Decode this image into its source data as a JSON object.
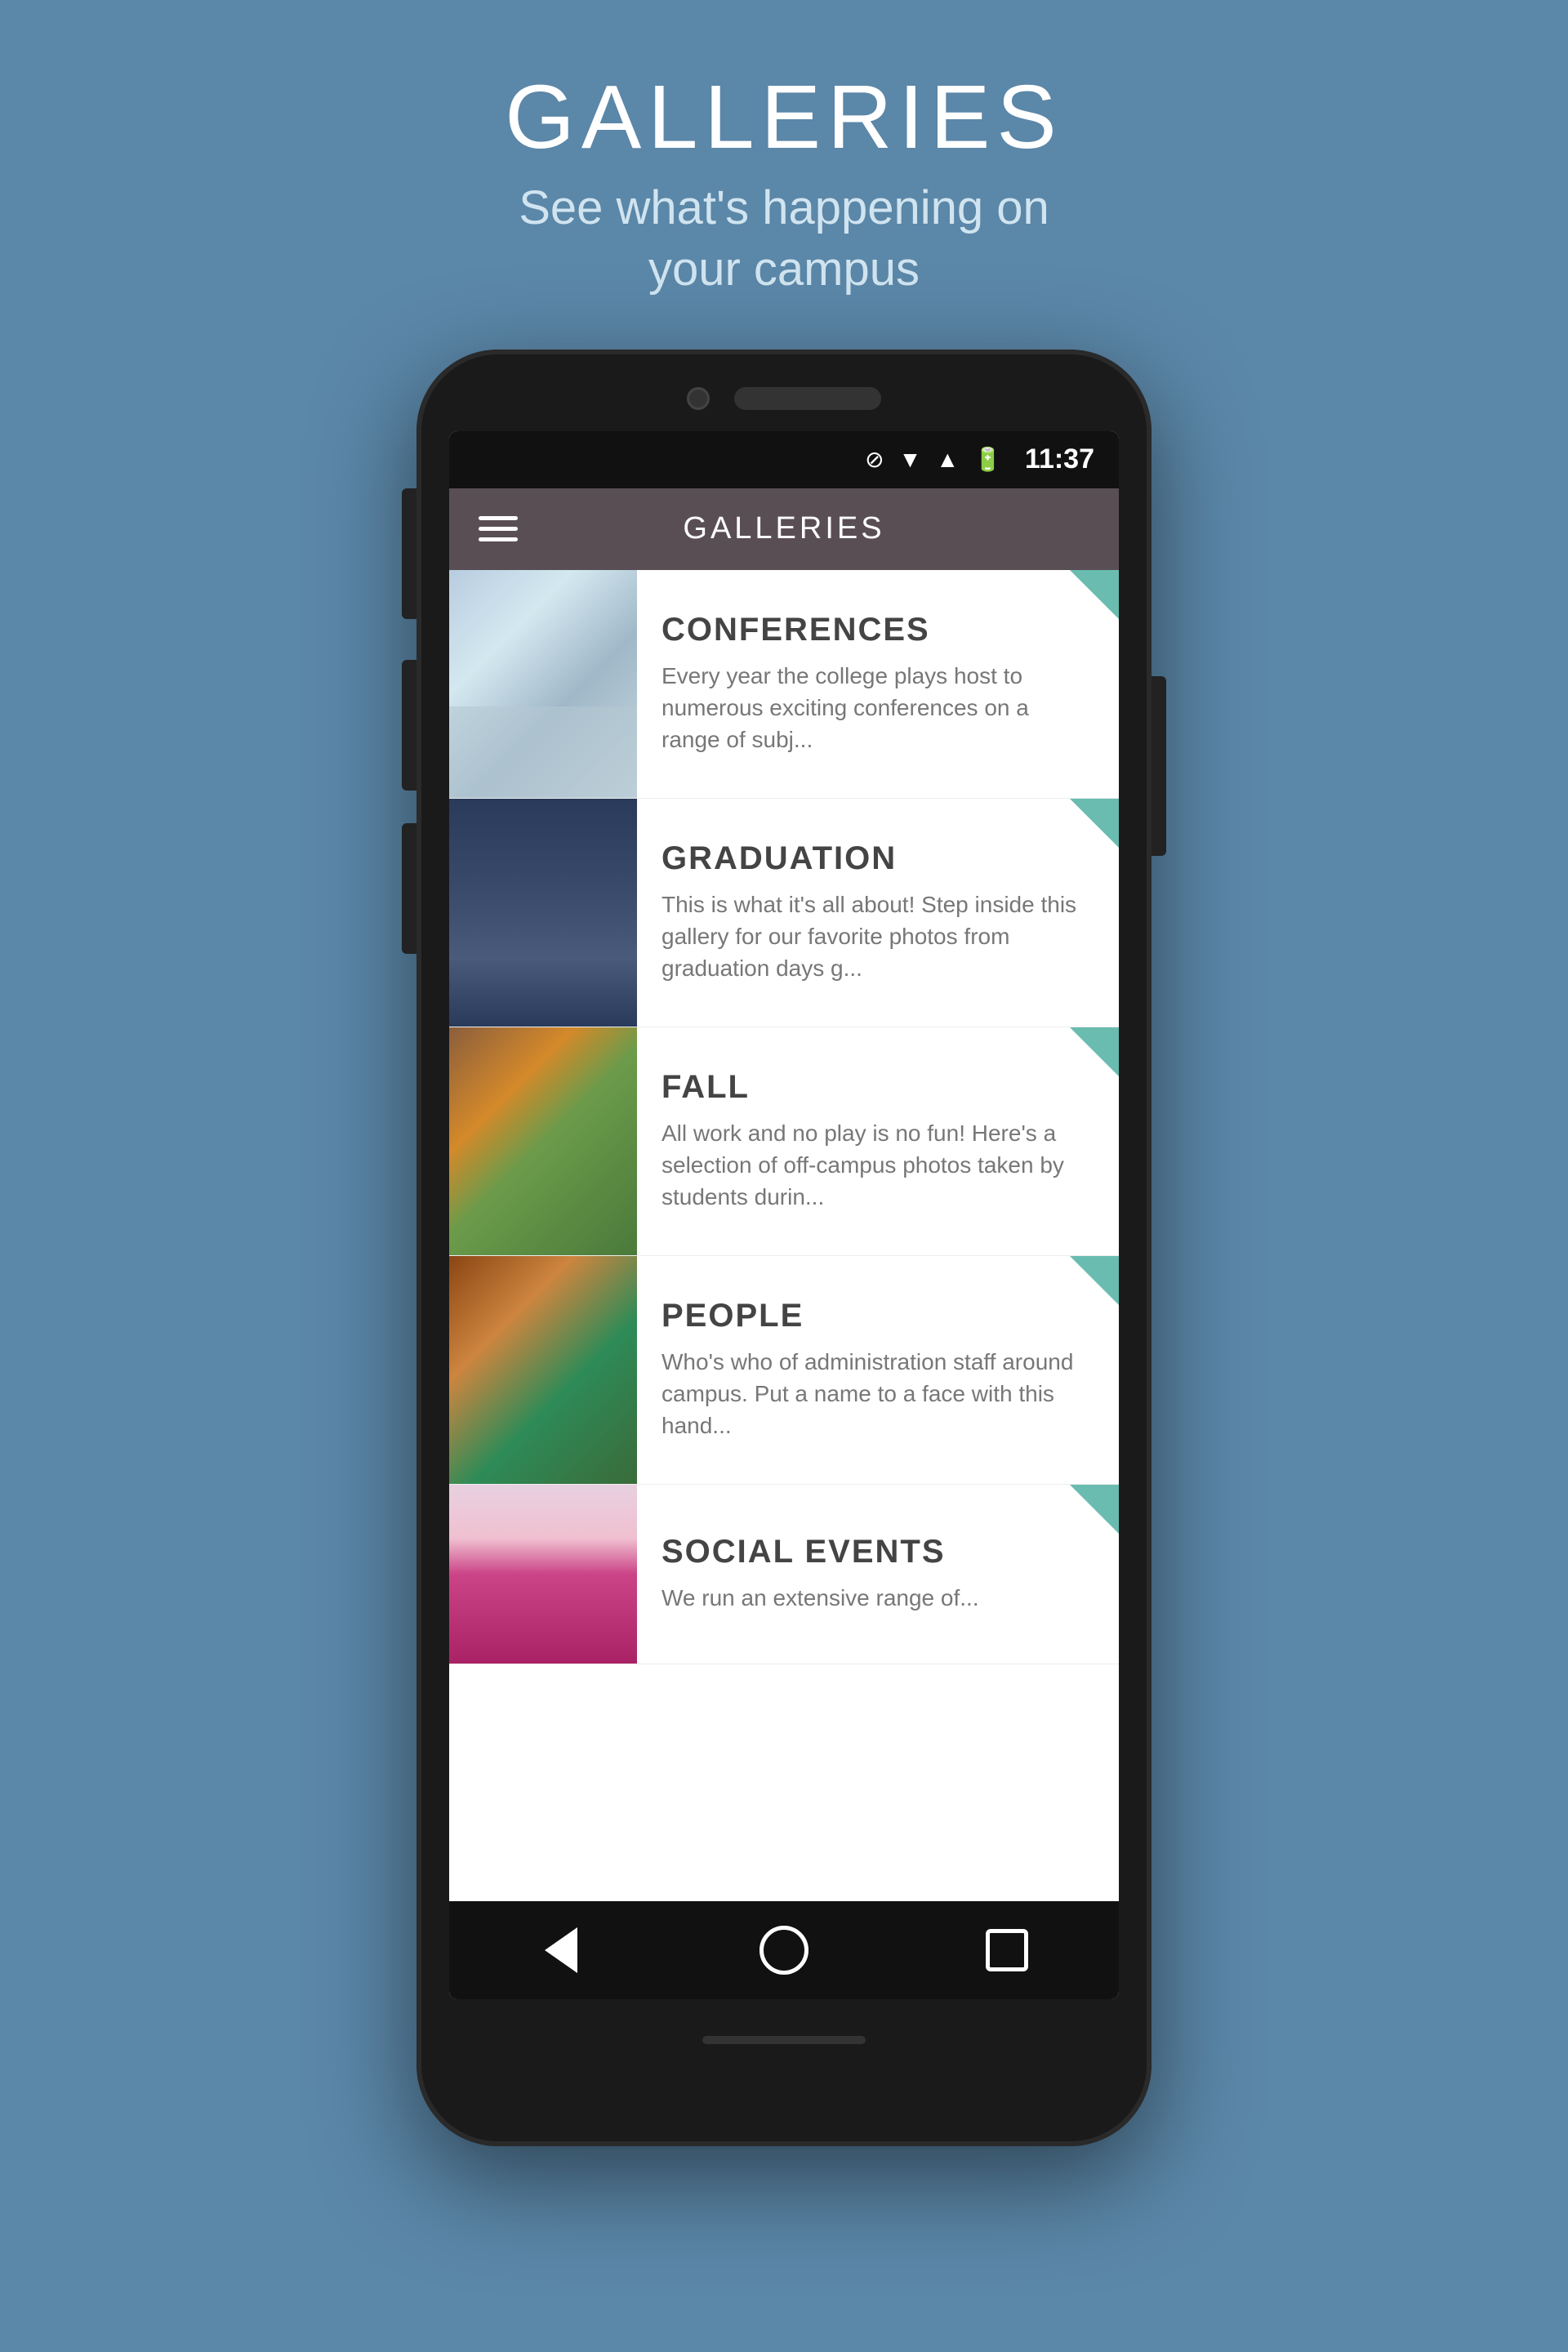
{
  "header": {
    "title": "GALLERIES",
    "subtitle": "See what's happening on\nyour campus"
  },
  "phone": {
    "status_bar": {
      "time": "11:37"
    },
    "app_bar": {
      "title": "GALLERIES"
    },
    "gallery_items": [
      {
        "id": "conferences",
        "title": "CONFERENCES",
        "description": "Every year the college plays host to numerous exciting conferences on a range of subj..."
      },
      {
        "id": "graduation",
        "title": "GRADUATION",
        "description": "This is what it's all about!  Step inside this gallery for our favorite photos from graduation days g..."
      },
      {
        "id": "fall",
        "title": "FALL",
        "description": "All work and no play is no fun!  Here's a selection of off-campus photos taken by students durin..."
      },
      {
        "id": "people",
        "title": "PEOPLE",
        "description": "Who's who of administration staff around campus.  Put a name to a face with this hand..."
      },
      {
        "id": "social-events",
        "title": "SOCIAL EVENTS",
        "description": "We run an extensive range of..."
      }
    ],
    "nav": {
      "back_label": "back",
      "home_label": "home",
      "recent_label": "recent"
    }
  }
}
